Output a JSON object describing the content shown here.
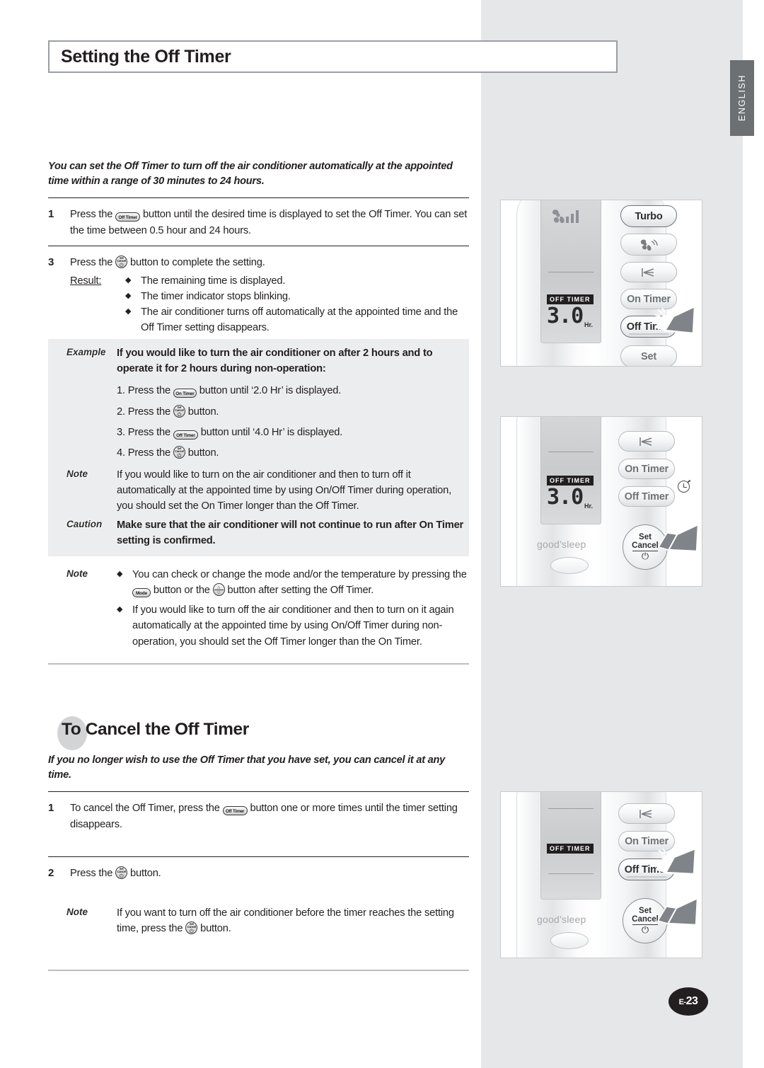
{
  "page": {
    "title": "Setting the Off Timer",
    "language_tab": "ENGLISH",
    "page_number_prefix": "E-",
    "page_number": "23",
    "background": "#ffffff",
    "panel_background": "#e6e7e8",
    "tab_background": "#6d7073"
  },
  "section1": {
    "lede": "You can set the Off Timer to turn off the air conditioner automatically at the appointed time within a range of 30 minutes to 24 hours.",
    "step1": {
      "number": "1",
      "text_a": "Press the",
      "icon": "off-timer-button",
      "icon_label": "Off Timer",
      "text_b": "button until the desired time is displayed to set the Off Timer. You can set the time between 0.5 hour and 24 hours."
    },
    "step3": {
      "number": "3",
      "text_a": "Press the",
      "icon": "set-cancel-button",
      "icon_label_line1": "Set",
      "icon_label_line2": "Cancel",
      "text_b": "button to complete the setting.",
      "result_label": "Result:",
      "results": [
        "The remaining time is displayed.",
        "The timer indicator stops blinking.",
        "The air conditioner turns off automatically at the appointed time and the Off Timer setting disappears."
      ]
    },
    "example": {
      "tag": "Example",
      "heading": "If you would like to turn the air conditioner on after 2 hours and to operate it for 2 hours during non-operation:",
      "steps": [
        {
          "num": "1.",
          "text_a": "Press the",
          "icon": "on-timer-button",
          "text_b": "button until ‘2.0 Hr’ is displayed."
        },
        {
          "num": "2.",
          "text_a": "Press the",
          "icon": "set-cancel-button",
          "text_b": "button."
        },
        {
          "num": "3.",
          "text_a": "Press the",
          "icon": "off-timer-button",
          "text_b": "button until ‘4.0 Hr’ is displayed."
        },
        {
          "num": "4.",
          "text_a": "Press the",
          "icon": "set-cancel-button",
          "text_b": "button."
        }
      ]
    },
    "note_shaded": {
      "tag": "Note",
      "text": "If you would like to turn on the air conditioner and then to turn off it automatically at the appointed time by using On/Off Timer during operation, you should set the On Timer longer than the Off Timer."
    },
    "caution": {
      "tag": "Caution",
      "text": "Make sure that the air conditioner will not continue to run after On Timer setting is confirmed."
    },
    "note_bullets": {
      "tag": "Note",
      "items": [
        {
          "text_a": "You can check or change the mode and/or the temperature by pressing the",
          "icon1": "mode-button",
          "text_b": "button or the",
          "icon2": "temperature-updown-button",
          "text_c": "button after setting the Off Timer."
        },
        {
          "text_a": "If you would like to turn off the air conditioner and then to turn on it again automatically at the appointed time by using On/Off Timer during non-operation, you should set the Off Timer longer than the On Timer.",
          "icon1": "",
          "text_b": "",
          "icon2": "",
          "text_c": ""
        }
      ]
    }
  },
  "section2": {
    "heading": "To Cancel the Off Timer",
    "lede": "If you no longer wish to use the Off Timer that you have set, you can cancel it at any time.",
    "step1": {
      "number": "1",
      "text_a": "To cancel the Off Timer, press the",
      "icon": "off-timer-button",
      "text_b": "button one or more times until the timer setting disappears."
    },
    "step2": {
      "number": "2",
      "text_a": "Press the",
      "icon": "set-cancel-button",
      "text_b": "button."
    },
    "note": {
      "tag": "Note",
      "text_a": "If you want to turn off the air conditioner before the timer reaches the setting time, press the",
      "icon": "set-cancel-button",
      "text_b": "button."
    }
  },
  "figures": [
    {
      "name": "remote-off-timer-set",
      "lcd": {
        "badge": "OFF  TIMER",
        "time": "3.0",
        "unit": "Hr.",
        "fan_indicator": true
      },
      "buttons": [
        "Turbo",
        "",
        "",
        "On Timer",
        "Off Timer",
        "Set"
      ],
      "highlight_button": "Off Timer",
      "cursors": 1
    },
    {
      "name": "remote-set-cancel-confirm",
      "lcd": {
        "badge": "OFF  TIMER",
        "time": "3.0",
        "unit": "Hr.",
        "brand": "good’sleep"
      },
      "buttons": [
        "",
        "On Timer",
        "Off Timer",
        "Set Cancel"
      ],
      "clock_icon": true,
      "highlight_button": "Set Cancel",
      "cursors": 1
    },
    {
      "name": "remote-cancel-off-timer",
      "lcd": {
        "badge": "OFF  TIMER",
        "time": "",
        "unit": "",
        "brand": "good’sleep"
      },
      "buttons": [
        "",
        "On Timer",
        "Off Timer",
        "Set Cancel"
      ],
      "highlight_button": "Off Timer",
      "cursors": 2
    }
  ],
  "labels": {
    "set": "Set",
    "cancel": "Cancel",
    "turbo": "Turbo",
    "on_timer": "On Timer",
    "off_timer": "Off Timer",
    "good_sleep": "good’sleep",
    "off_timer_badge": "OFF  TIMER",
    "time_value": "3.0",
    "time_unit": "Hr.",
    "power_glyph": "⏻"
  }
}
